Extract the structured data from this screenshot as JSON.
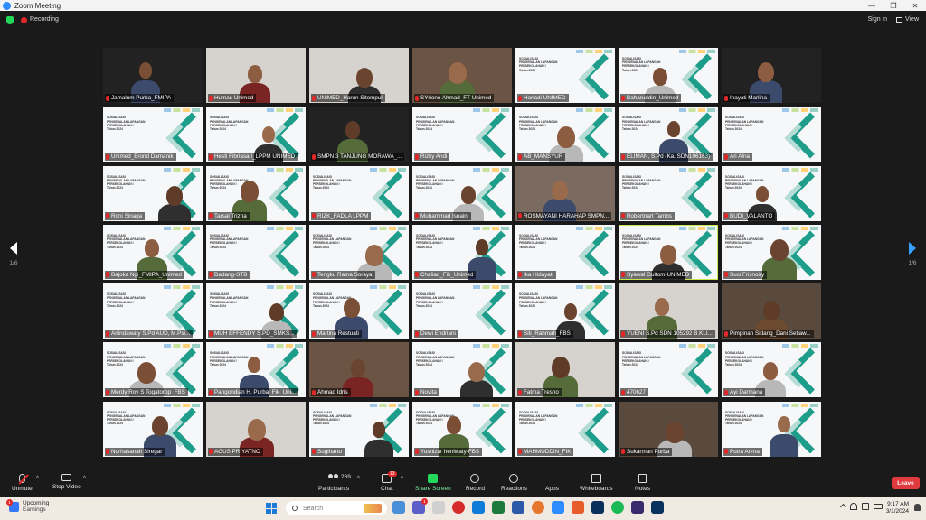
{
  "window": {
    "title": "Zoom Meeting",
    "controls": [
      "—",
      "❐",
      "✕"
    ]
  },
  "topbar": {
    "recording_label": "Recording",
    "sign_in": "Sign in",
    "view": "View"
  },
  "pager": {
    "left_page": "1/6",
    "right_page": "1/6"
  },
  "participants": [
    {
      "name": "Jamalum Purba_FMIPA",
      "type": "dark"
    },
    {
      "name": "Humas Unimed",
      "type": "light"
    },
    {
      "name": "UNIMED_Harun Sitompul",
      "type": "light"
    },
    {
      "name": "SYriono Ahmad_FT-Unimed",
      "type": "room"
    },
    {
      "name": "Hariadi UNIMED",
      "type": "slide"
    },
    {
      "name": "Baharuddin_Unimed",
      "type": "slide"
    },
    {
      "name": "Inayati Marlina",
      "type": "dark"
    },
    {
      "name": "Unimed_Erond Damanik",
      "type": "slide"
    },
    {
      "name": "Hesti Fibriasari_LPPM UNIMED",
      "type": "slide"
    },
    {
      "name": "SMPN 3 TANJUNG MORAWA_...",
      "type": "dark"
    },
    {
      "name": "Rizky Andi",
      "type": "slide"
    },
    {
      "name": "AB_MANSYUR",
      "type": "slide"
    },
    {
      "name": "ELIMAN, S.Pd (Ka. SDN106163)",
      "type": "slide"
    },
    {
      "name": "Ari Afna",
      "type": "slide"
    },
    {
      "name": "Roni Sinaga",
      "type": "slide"
    },
    {
      "name": "Tarsal Trizna",
      "type": "slide"
    },
    {
      "name": "RIZK_FADLA LPPM",
      "type": "slide"
    },
    {
      "name": "Muhammad Isnaini",
      "type": "slide"
    },
    {
      "name": "ROSMAYANI HARAHAP SMPN...",
      "type": "rosmayani"
    },
    {
      "name": "Robertnart Tambs",
      "type": "slide"
    },
    {
      "name": "BUDI_VALANTO",
      "type": "slide"
    },
    {
      "name": "Bajoka Ngi_FMIPA_Unimed",
      "type": "slide"
    },
    {
      "name": "Dadang-STB",
      "type": "slide"
    },
    {
      "name": "Tengku Ratna Soraya",
      "type": "slide"
    },
    {
      "name": "Chaliad_Fik_Unimed",
      "type": "slide"
    },
    {
      "name": "Ika Hidayati",
      "type": "slide"
    },
    {
      "name": "Syawal Gultom-UNIMED",
      "type": "slide"
    },
    {
      "name": "Suci Frisnoiry",
      "type": "slide"
    },
    {
      "name": "Arlindawaty S.Pd AUD, M.Psi...",
      "type": "slide"
    },
    {
      "name": "MUH EFFENDY S.PD_SMKS...",
      "type": "slide"
    },
    {
      "name": "Martina Restuati",
      "type": "slide"
    },
    {
      "name": "Dewi Endriani",
      "type": "slide"
    },
    {
      "name": "Siti_Rahmah_FBS",
      "type": "slide"
    },
    {
      "name": "YUENI S.Pd SDN 105292 B.KLI...",
      "type": "light"
    },
    {
      "name": "Pimpinan Sidang_Dani Setiaw...",
      "type": "brown"
    },
    {
      "name": "Merdy Roy S Togatorop_FBS",
      "type": "slide"
    },
    {
      "name": "Pangondian H. Purba_Fik_Uni...",
      "type": "slide"
    },
    {
      "name": "Ahmad Idris",
      "type": "room"
    },
    {
      "name": "Novita",
      "type": "slide"
    },
    {
      "name": "Fatma Tresno",
      "type": "light"
    },
    {
      "name": "470627",
      "type": "slide"
    },
    {
      "name": "Ayi Darmana",
      "type": "slide"
    },
    {
      "name": "Nurhasanah Siregar",
      "type": "slide"
    },
    {
      "name": "AGUS PRIYATNO",
      "type": "light"
    },
    {
      "name": "Sugiharto",
      "type": "slide"
    },
    {
      "name": "Yusnizar heniwaty-FBS",
      "type": "slide"
    },
    {
      "name": "MAHMUDDIN_FIK",
      "type": "slide"
    },
    {
      "name": "Sukarman Purba",
      "type": "brown"
    },
    {
      "name": "Putra Arima",
      "type": "slide"
    }
  ],
  "slide_text": "SOSIALISASI\nPENGENALAN LAPANGAN\nPERSEKOLAHAN I\nTahun 2024",
  "toolbar": {
    "unmute": "Unmute",
    "stop_video": "Stop Video",
    "participants": "Participants",
    "participants_count": "269",
    "chat": "Chat",
    "chat_badge": "13",
    "share_screen": "Share Screen",
    "record": "Record",
    "reactions": "Reactions",
    "apps": "Apps",
    "whiteboards": "Whiteboards",
    "notes": "Notes",
    "leave": "Leave"
  },
  "taskbar": {
    "weather_title": "Upcoming",
    "weather_sub": "Earnings",
    "weather_badge": "1",
    "search_placeholder": "Search",
    "time": "9:17 AM",
    "date": "3/1/2024"
  },
  "colors": {
    "accent": "#2d8cff",
    "share_green": "#23d959",
    "leave_red": "#e0393e",
    "slide_teal": "#1e9d8b",
    "active_speaker": "#c6e84a"
  }
}
